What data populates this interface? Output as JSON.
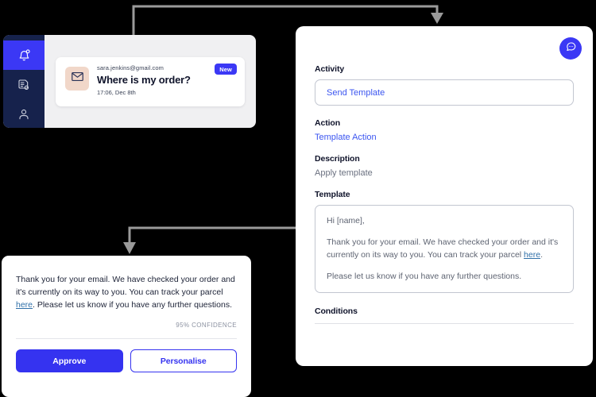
{
  "colors": {
    "accent_blue": "#3B38F5",
    "button_blue": "#3533F0",
    "sidebar_navy": "#16224C",
    "panel_gray": "#F0F0F2",
    "link_teal": "#2F6FA8",
    "connector_gray": "#9A9A9A",
    "envelope_peach": "#F1D7C9"
  },
  "inbox": {
    "sidebar": {
      "items": [
        {
          "icon": "bell-notification-icon",
          "active": true
        },
        {
          "icon": "document-settings-icon",
          "active": false
        },
        {
          "icon": "user-profile-icon",
          "active": false
        }
      ]
    },
    "email": {
      "from": "sara.jenkins@gmail.com",
      "subject": "Where is my order?",
      "time": "17:06, Dec 8th",
      "badge": "New",
      "avatar_icon": "envelope-icon"
    }
  },
  "detail": {
    "chat_icon": "chat-bubble-icon",
    "activity": {
      "label": "Activity",
      "value": "Send Template"
    },
    "action": {
      "label": "Action",
      "value": "Template Action"
    },
    "description": {
      "label": "Description",
      "value": "Apply template"
    },
    "template": {
      "label": "Template",
      "greeting": "Hi [name],",
      "body_part1": "Thank you for your email. We have checked your order and it's currently on its way to you. You can track your parcel ",
      "body_link": "here",
      "body_part2": ".",
      "closing": "Please let us know if you have any further questions."
    },
    "conditions": {
      "label": "Conditions"
    }
  },
  "reply": {
    "text_part1": "Thank you for your email. We have checked your order and it's currently on its way to you. You can track your parcel ",
    "text_link": "here",
    "text_part2": ". Please let us know if you have any further questions.",
    "confidence": "95% CONFIDENCE",
    "approve_label": "Approve",
    "personalise_label": "Personalise"
  }
}
